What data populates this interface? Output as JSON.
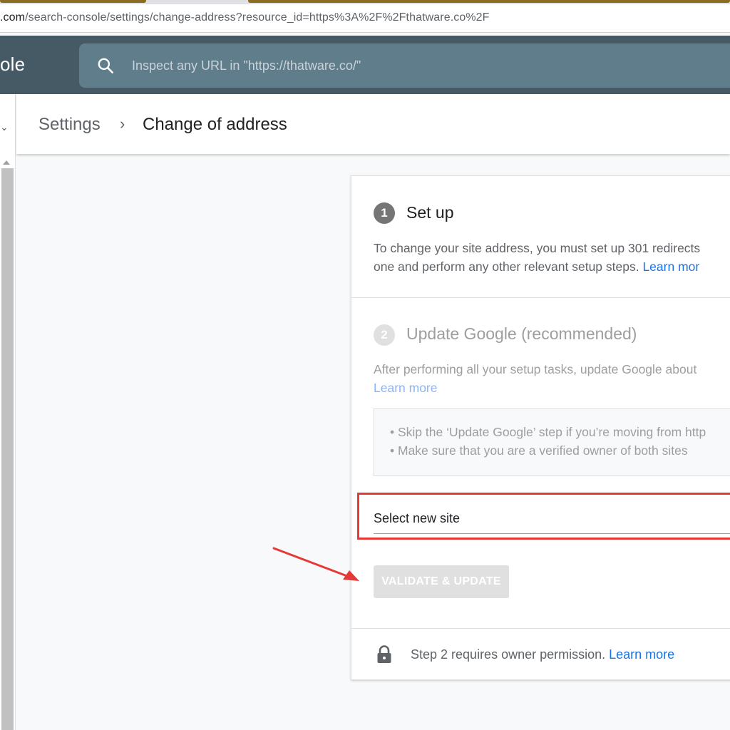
{
  "browser": {
    "url_host": ".com",
    "url_path": "/search-console/settings/change-address?resource_id=https%3A%2F%2Fthatware.co%2F"
  },
  "header": {
    "logo_text": "ole",
    "search_placeholder": "Inspect any URL in \"https://thatware.co/\"",
    "search_icon": "search-icon"
  },
  "breadcrumb": {
    "parent": "Settings",
    "separator": "›",
    "current": "Change of address"
  },
  "step1": {
    "number": "1",
    "title": "Set up",
    "desc_line1": "To change your site address, you must set up 301 redirects",
    "desc_line2": "one and perform any other relevant setup steps. ",
    "link": "Learn mor"
  },
  "step2": {
    "number": "2",
    "title": "Update Google (recommended)",
    "desc_line1": "After performing all your setup tasks, update Google about",
    "link": "Learn more",
    "tips": [
      "• Skip the ‘Update Google’ step if you’re moving from http",
      "• Make sure that you are a verified owner of both sites"
    ],
    "select_label": "Select new site",
    "validate_label": "VALIDATE & UPDATE"
  },
  "footer": {
    "text": "Step 2 requires owner permission. ",
    "link": "Learn more",
    "icon": "lock-icon"
  },
  "colors": {
    "appbar": "#455a64",
    "search": "#607d8b",
    "link": "#1a73e8",
    "annotation": "#e53935"
  }
}
